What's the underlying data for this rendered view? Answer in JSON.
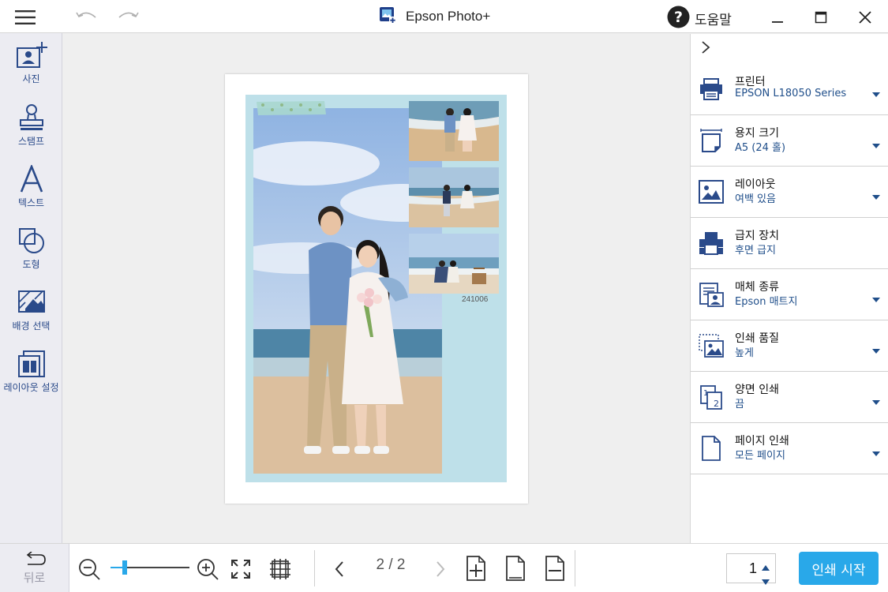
{
  "window": {
    "title": "Epson Photo+",
    "help_label": "도움말"
  },
  "sidebar": {
    "tools": [
      {
        "label": "사진"
      },
      {
        "label": "스탬프"
      },
      {
        "label": "텍스트"
      },
      {
        "label": "도형"
      },
      {
        "label": "배경 선택"
      },
      {
        "label": "레이아웃 설정"
      }
    ]
  },
  "canvas": {
    "photo_date": "241006"
  },
  "settings": [
    {
      "title": "프린터",
      "value": "EPSON L18050 Series",
      "icon": "printer-icon",
      "dropdown": true
    },
    {
      "title": "용지 크기",
      "value": "A5 (24 홀)",
      "icon": "paper-size-icon",
      "dropdown": true
    },
    {
      "title": "레이아웃",
      "value": "여백 있음",
      "icon": "layout-icon",
      "dropdown": true
    },
    {
      "title": "급지 장치",
      "value": "후면 급지",
      "icon": "paper-feed-icon",
      "dropdown": false
    },
    {
      "title": "매체 종류",
      "value": "Epson 매트지",
      "icon": "media-type-icon",
      "dropdown": true
    },
    {
      "title": "인쇄 품질",
      "value": "높게",
      "icon": "print-quality-icon",
      "dropdown": true
    },
    {
      "title": "양면 인쇄",
      "value": "끔",
      "icon": "duplex-icon",
      "dropdown": true
    },
    {
      "title": "페이지 인쇄",
      "value": "모든 페이지",
      "icon": "page-print-icon",
      "dropdown": true
    }
  ],
  "bottom": {
    "back_label": "뒤로",
    "page_indicator": "2 / 2",
    "copies": "1",
    "print_label": "인쇄 시작",
    "zoom_level": 0.18
  },
  "colors": {
    "accent": "#29a8e9",
    "icon_blue": "#2a4a8a",
    "page_background": "#bee0e9"
  }
}
